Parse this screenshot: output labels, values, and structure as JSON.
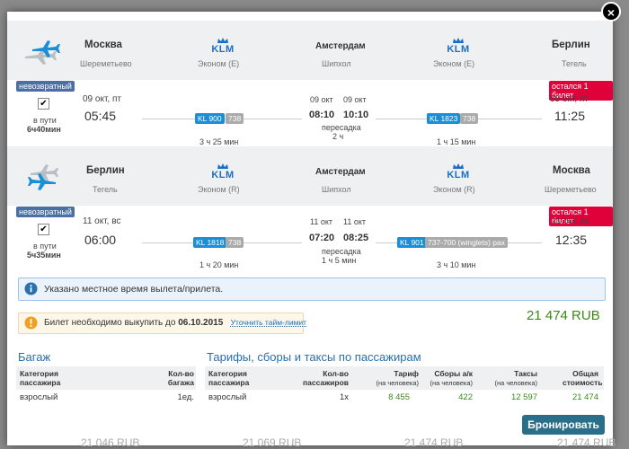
{
  "close_label": "×",
  "segments": [
    {
      "from_city": "Москва",
      "from_airport": "Шереметьево",
      "via_city": "Амстердам",
      "via_airport": "Шипхол",
      "to_city": "Берлин",
      "to_airport": "Тегель",
      "airline1": "KLM",
      "class1": "Эконом (E)",
      "airline2": "KLM",
      "class2": "Эконом (E)",
      "refund_badge": "невозвратный",
      "seats_badge": "остался 1 билет",
      "enroute_label": "в пути",
      "enroute_time": "6ч40мин",
      "dep_date": "09 окт, пт",
      "dep_time": "05:45",
      "flight1": "KL 900",
      "aircraft1": "738",
      "dur1": "3 ч 25 мин",
      "arr_mid_date": "09 окт",
      "arr_mid_time": "08:10",
      "dep_mid_date": "09 окт",
      "dep_mid_time": "10:10",
      "transfer_label": "пересадка",
      "transfer_time": "2 ч",
      "flight2": "KL 1823",
      "aircraft2": "738",
      "dur2": "1 ч 15 мин",
      "arr_date": "09 окт, пт",
      "arr_time": "11:25"
    },
    {
      "from_city": "Берлин",
      "from_airport": "Тегель",
      "via_city": "Амстердам",
      "via_airport": "Шипхол",
      "to_city": "Москва",
      "to_airport": "Шереметьево",
      "airline1": "KLM",
      "class1": "Эконом (R)",
      "airline2": "KLM",
      "class2": "Эконом (R)",
      "refund_badge": "невозвратный",
      "seats_badge": "остался 1 билет",
      "enroute_label": "в пути",
      "enroute_time": "5ч35мин",
      "dep_date": "11 окт, вс",
      "dep_time": "06:00",
      "flight1": "KL 1818",
      "aircraft1": "738",
      "dur1": "1 ч 20 мин",
      "arr_mid_date": "11 окт",
      "arr_mid_time": "07:20",
      "dep_mid_date": "11 окт",
      "dep_mid_time": "08:25",
      "transfer_label": "пересадка",
      "transfer_time": "1 ч 5 мин",
      "flight2": "KL 901",
      "aircraft2": "737-700 (winglets) pax",
      "dur2": "3 ч 10 мин",
      "arr_date": "11 окт, вс",
      "arr_time": "12:35"
    }
  ],
  "info_text": "Указано местное время вылета/прилета.",
  "warn": {
    "text": "Билет необходимо выкупить до",
    "date": "06.10.2015",
    "link": "Уточнить тайм-лимит"
  },
  "total_price": "21 474 RUB",
  "baggage": {
    "title": "Багаж",
    "h1": "Категория пассажира",
    "h2": "Кол-во багажа",
    "row": {
      "cat": "взрослый",
      "qty": "1ед."
    }
  },
  "fares": {
    "title": "Тарифы, сборы и таксы по пассажирам",
    "h_cat": "Категория пассажира",
    "h_qty": "Кол-во пассажиров",
    "h_fare": "Тариф",
    "h_fare_sub": "(на человека)",
    "h_fee": "Сборы а/к",
    "h_fee_sub": "(на человека)",
    "h_tax": "Таксы",
    "h_tax_sub": "(на человека)",
    "h_total": "Общая стоимость",
    "row": {
      "cat": "взрослый",
      "qty": "1x",
      "fare": "8 455",
      "fee": "422",
      "tax": "12 597",
      "total": "21 474"
    }
  },
  "book_button": "Бронировать",
  "background_prices": [
    "21 046 RUB",
    "21 069 RUB",
    "21 474 RUB",
    "21 474 RUB"
  ],
  "colors": {
    "accent": "#1a6fc4",
    "price": "#3a8a1a",
    "badge_red": "#e0003a",
    "button": "#2a6f8a"
  }
}
